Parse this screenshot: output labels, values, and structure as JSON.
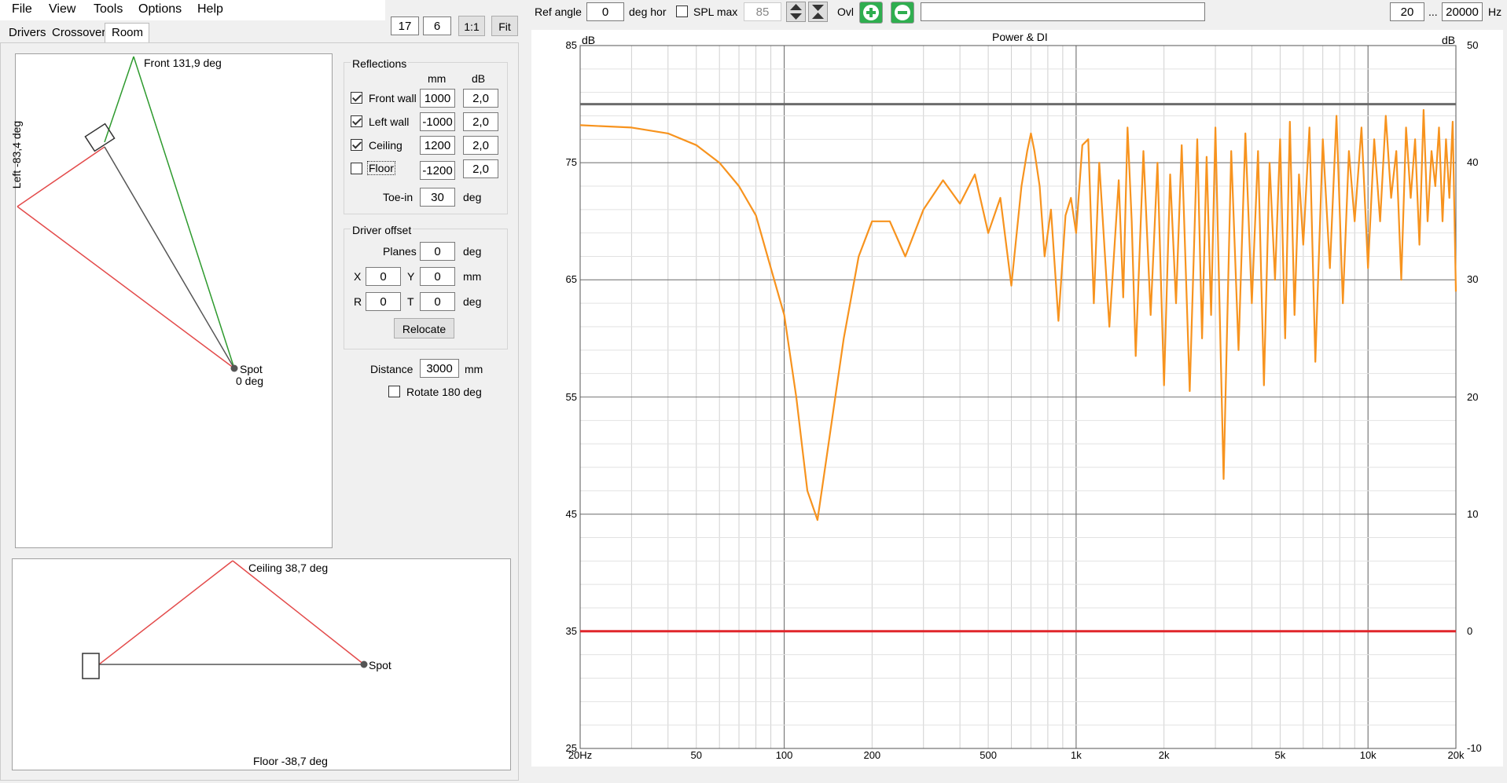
{
  "menu": {
    "file": "File",
    "view": "View",
    "tools": "Tools",
    "options": "Options",
    "help": "Help"
  },
  "tabs": {
    "drivers": "Drivers",
    "crossover": "Crossover",
    "room": "Room"
  },
  "toolbar": {
    "num1": "17",
    "num2": "6",
    "one_to_one": "1:1",
    "fit": "Fit"
  },
  "top_plan": {
    "front_label": "Front 131,9 deg",
    "left_label": "Left -83,4 deg",
    "spot_label": "Spot",
    "spot_deg": "0 deg"
  },
  "side_view": {
    "ceiling_label": "Ceiling 38,7 deg",
    "floor_label": "Floor -38,7 deg",
    "spot_label": "Spot"
  },
  "reflections": {
    "title": "Reflections",
    "col_mm": "mm",
    "col_db": "dB",
    "rows": [
      {
        "label": "Front wall",
        "mm": "1000",
        "db": "2,0",
        "checked": true
      },
      {
        "label": "Left wall",
        "mm": "-1000",
        "db": "2,0",
        "checked": true
      },
      {
        "label": "Ceiling",
        "mm": "1200",
        "db": "2,0",
        "checked": true
      },
      {
        "label": "Floor",
        "mm": "-1200",
        "db": "2,0",
        "checked": false
      }
    ],
    "toein_label": "Toe-in",
    "toein_value": "30",
    "toein_unit": "deg"
  },
  "driver_offset": {
    "title": "Driver offset",
    "planes_label": "Planes",
    "planes_value": "0",
    "planes_unit": "deg",
    "x_label": "X",
    "x_value": "0",
    "y_label": "Y",
    "y_value": "0",
    "xy_unit": "mm",
    "r_label": "R",
    "r_value": "0",
    "t_label": "T",
    "t_value": "0",
    "rt_unit": "deg",
    "relocate": "Relocate"
  },
  "distance": {
    "label": "Distance",
    "value": "3000",
    "unit": "mm"
  },
  "rotate": {
    "label": "Rotate 180 deg",
    "checked": false
  },
  "graph_toolbar": {
    "ref_angle_label": "Ref angle",
    "ref_angle_value": "0",
    "deg_hor": "deg hor",
    "spl_max_label": "SPL max",
    "spl_max_value": "85",
    "ovl_label": "Ovl",
    "freq_min": "20",
    "ellipsis": "...",
    "freq_max": "20000",
    "hz": "Hz"
  },
  "colors": {
    "accent_green": "#27a844",
    "orange": "#f7931e",
    "red_line": "#e0262b",
    "grey_line": "#6b6b6b"
  },
  "chart_data": {
    "type": "line",
    "title": "Power & DI",
    "ylabel_left": "dB",
    "ylabel_right": "dB",
    "x_scale": "log",
    "xlim": [
      20,
      20000
    ],
    "x_ticks": [
      {
        "v": 20,
        "t": "20Hz"
      },
      {
        "v": 50,
        "t": "50"
      },
      {
        "v": 100,
        "t": "100"
      },
      {
        "v": 200,
        "t": "200"
      },
      {
        "v": 500,
        "t": "500"
      },
      {
        "v": 1000,
        "t": "1k"
      },
      {
        "v": 2000,
        "t": "2k"
      },
      {
        "v": 5000,
        "t": "5k"
      },
      {
        "v": 10000,
        "t": "10k"
      },
      {
        "v": 20000,
        "t": "20k"
      }
    ],
    "ylim_left": [
      25,
      85
    ],
    "y_ticks_left": [
      "85",
      "75",
      "65",
      "55",
      "45",
      "35",
      "25"
    ],
    "ylim_right": [
      -10,
      50
    ],
    "y_ticks_right": [
      "50",
      "40",
      "30",
      "20",
      "10",
      "0",
      "-10"
    ],
    "grid": true,
    "series": [
      {
        "axis": "left",
        "color": "#f7931e",
        "x": [
          20,
          30,
          40,
          50,
          60,
          70,
          80,
          90,
          100,
          110,
          120,
          130,
          140,
          160,
          180,
          200,
          230,
          260,
          300,
          350,
          400,
          450,
          500,
          550,
          600,
          650,
          680,
          700,
          720,
          750,
          780,
          820,
          870,
          920,
          960,
          1000,
          1050,
          1100,
          1150,
          1200,
          1300,
          1400,
          1450,
          1500,
          1550,
          1600,
          1700,
          1800,
          1900,
          2000,
          2100,
          2200,
          2300,
          2450,
          2600,
          2700,
          2800,
          2900,
          3000,
          3200,
          3400,
          3600,
          3800,
          4000,
          4200,
          4400,
          4600,
          4800,
          5000,
          5200,
          5400,
          5600,
          5800,
          6000,
          6300,
          6600,
          7000,
          7400,
          7800,
          8200,
          8600,
          9000,
          9500,
          10000,
          10500,
          11000,
          11500,
          12000,
          12500,
          13000,
          13500,
          14000,
          14500,
          15000,
          15500,
          16000,
          16500,
          17000,
          17500,
          18000,
          18500,
          19000,
          19500,
          20000
        ],
        "y": [
          78.2,
          78.0,
          77.5,
          76.5,
          75.0,
          73.0,
          70.5,
          66.0,
          62.0,
          55.0,
          47.0,
          44.5,
          50.0,
          60.0,
          67.0,
          70.0,
          70.0,
          67.0,
          71.0,
          73.5,
          71.5,
          74.0,
          69.0,
          72.0,
          64.5,
          73.0,
          76.0,
          77.5,
          76.0,
          73.0,
          67.0,
          71.0,
          61.5,
          70.5,
          72.0,
          69.0,
          76.5,
          77.0,
          63.0,
          75.0,
          61.0,
          73.5,
          63.5,
          78.0,
          70.0,
          58.5,
          76.0,
          62.0,
          75.0,
          56.0,
          74.0,
          63.0,
          76.5,
          55.5,
          77.0,
          60.0,
          75.5,
          62.0,
          78.0,
          48.0,
          76.0,
          59.0,
          77.5,
          63.0,
          76.0,
          56.0,
          75.0,
          65.0,
          77.0,
          60.0,
          78.5,
          62.0,
          74.0,
          68.0,
          78.0,
          58.0,
          77.0,
          66.0,
          79.0,
          63.0,
          76.0,
          70.0,
          78.0,
          66.0,
          77.0,
          70.0,
          79.0,
          72.0,
          76.0,
          65.0,
          78.0,
          72.0,
          77.0,
          68.0,
          79.5,
          70.0,
          76.0,
          73.0,
          78.0,
          70.0,
          77.0,
          72.0,
          78.5,
          64.0
        ]
      },
      {
        "axis": "left",
        "color": "#6b6b6b",
        "x": [
          20,
          20000
        ],
        "y": [
          80,
          80
        ]
      },
      {
        "axis": "right",
        "color": "#e0262b",
        "x": [
          20,
          20000
        ],
        "y": [
          0,
          0
        ]
      }
    ]
  }
}
